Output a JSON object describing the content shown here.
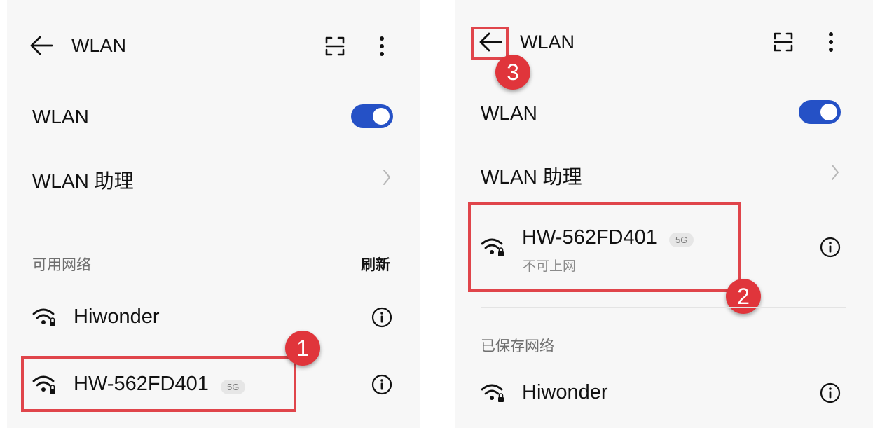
{
  "left": {
    "header": {
      "title": "WLAN"
    },
    "wlan_toggle": {
      "label": "WLAN",
      "state": "on"
    },
    "wlan_assistant": {
      "label": "WLAN 助理"
    },
    "available": {
      "section_label": "可用网络",
      "refresh_label": "刷新",
      "networks": [
        {
          "name": "Hiwonder",
          "badge": ""
        },
        {
          "name": "HW-562FD401",
          "badge": "5G"
        }
      ]
    },
    "step_marker": "1"
  },
  "right": {
    "header": {
      "title": "WLAN"
    },
    "back_step_marker": "3",
    "wlan_toggle": {
      "label": "WLAN",
      "state": "on"
    },
    "wlan_assistant": {
      "label": "WLAN 助理"
    },
    "connected": {
      "name": "HW-562FD401",
      "badge": "5G",
      "status": "不可上网"
    },
    "connected_step_marker": "2",
    "saved": {
      "section_label": "已保存网络",
      "networks": [
        {
          "name": "Hiwonder"
        }
      ]
    }
  },
  "colors": {
    "toggle_on": "#2551c6",
    "annotation_red": "#e0353b",
    "panel_bg": "#f7f7f7"
  },
  "icons": [
    "back-arrow-icon",
    "scan-icon",
    "more-vert-icon",
    "chevron-right-icon",
    "wifi-lock-icon",
    "info-icon"
  ]
}
